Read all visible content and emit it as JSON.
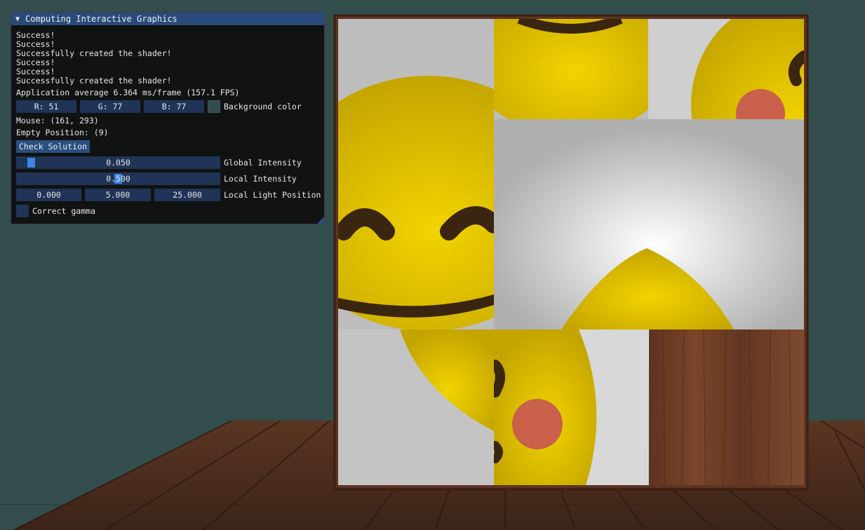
{
  "window": {
    "title": "Computing Interactive Graphics",
    "log": [
      "Success!",
      "Success!",
      "Successfully created the shader!",
      "Success!",
      "Success!",
      "Successfully created the shader!"
    ],
    "fps_text": "Application average 6.364 ms/frame (157.1 FPS)",
    "background_color": {
      "r": "R: 51",
      "g": "G: 77",
      "b": "B: 77",
      "label": "Background color",
      "hex": "#334d4d"
    },
    "mouse_text": "Mouse: (161, 293)",
    "empty_position_text": "Empty Position: (9)",
    "check_button": "Check Solution",
    "global_intensity": {
      "value": "0.050",
      "label": "Global Intensity",
      "fraction": 0.05
    },
    "local_intensity": {
      "value": "0.500",
      "label": "Local Intensity",
      "fraction": 0.5
    },
    "local_light_position": {
      "x": "0.000",
      "y": "5.000",
      "z": "25.000",
      "label": "Local Light Position"
    },
    "correct_gamma": {
      "label": "Correct gamma",
      "checked": false
    }
  },
  "puzzle": {
    "grid": "3x3",
    "empty_tile": 9,
    "tile_image": "smiling-emoji-face",
    "empty_texture": "wood"
  },
  "colors": {
    "clear": "#334d4d",
    "emoji_yellow": "#f0cc00",
    "cheek": "#c8604a",
    "wood": "#6b3a22",
    "panel_bg": "#0f0f0f",
    "frame_bg": "#1f3457",
    "title_bg": "#294a7a"
  }
}
